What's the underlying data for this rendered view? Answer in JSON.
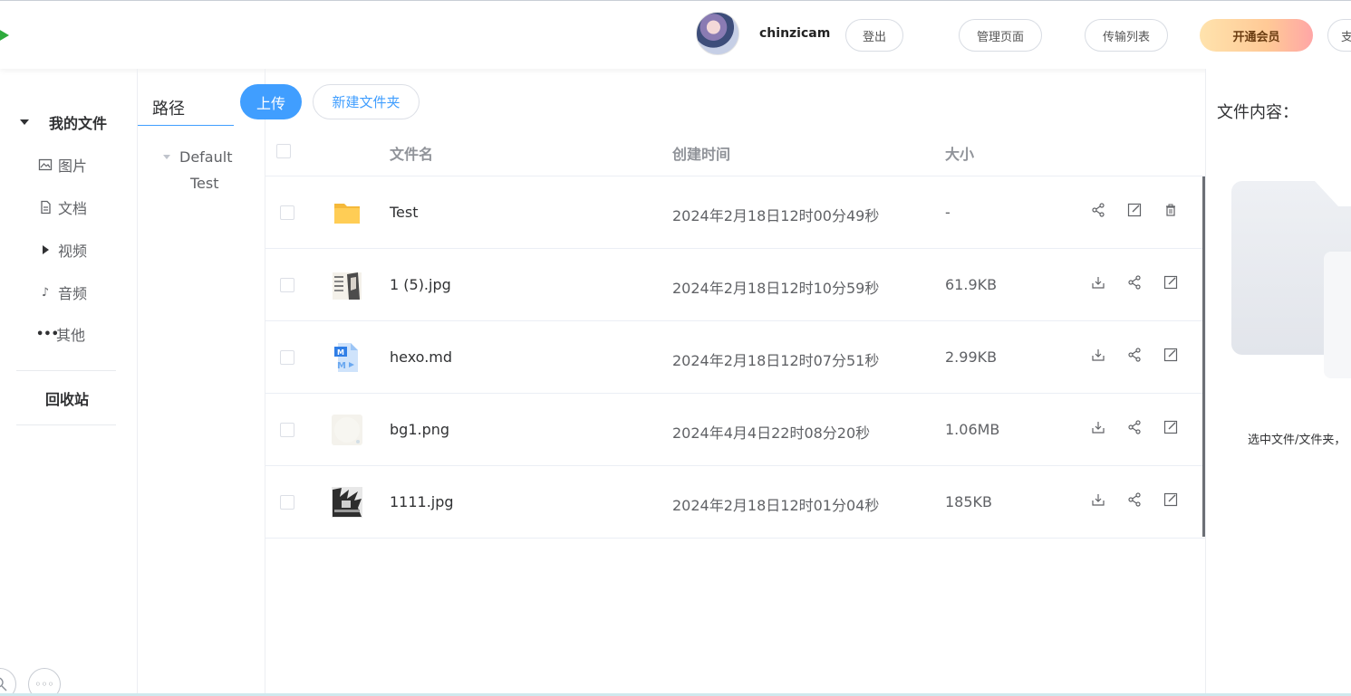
{
  "header": {
    "username": "chinzicam",
    "logout_label": "登出",
    "admin_label": "管理页面",
    "transfer_label": "传输列表",
    "vip_label": "开通会员",
    "more_label": "支"
  },
  "sidebar": {
    "title": "我的文件",
    "items": [
      {
        "label": "图片",
        "icon": "image-icon"
      },
      {
        "label": "文档",
        "icon": "document-icon"
      },
      {
        "label": "视频",
        "icon": "play-icon"
      },
      {
        "label": "音频",
        "icon": "music-note-icon"
      },
      {
        "label": "其他",
        "icon": "more-dots-icon"
      }
    ],
    "recycle_label": "回收站"
  },
  "tree": {
    "path_label": "路径",
    "root": "Default",
    "child": "Test"
  },
  "toolbar": {
    "upload_label": "上传",
    "new_folder_label": "新建文件夹"
  },
  "table": {
    "columns": [
      "文件名",
      "创建时间",
      "大小"
    ],
    "rows": [
      {
        "name": "Test",
        "time": "2024年2月18日12时00分49秒",
        "size": "-",
        "type": "folder"
      },
      {
        "name": "1 (5).jpg",
        "time": "2024年2月18日12时10分59秒",
        "size": "61.9KB",
        "type": "image"
      },
      {
        "name": "hexo.md",
        "time": "2024年2月18日12时07分51秒",
        "size": "2.99KB",
        "type": "markdown"
      },
      {
        "name": "bg1.png",
        "time": "2024年4月4日22时08分20秒",
        "size": "1.06MB",
        "type": "image-light"
      },
      {
        "name": "1111.jpg",
        "time": "2024年2月18日12时01分04秒",
        "size": "185KB",
        "type": "image-dark"
      }
    ]
  },
  "preview": {
    "title": "文件内容：",
    "tip": "选中文件/文件夹，"
  },
  "colors": {
    "accent": "#409eff",
    "vip_gradient_start": "#ffe3ad",
    "vip_gradient_end": "#ffa6a6"
  }
}
